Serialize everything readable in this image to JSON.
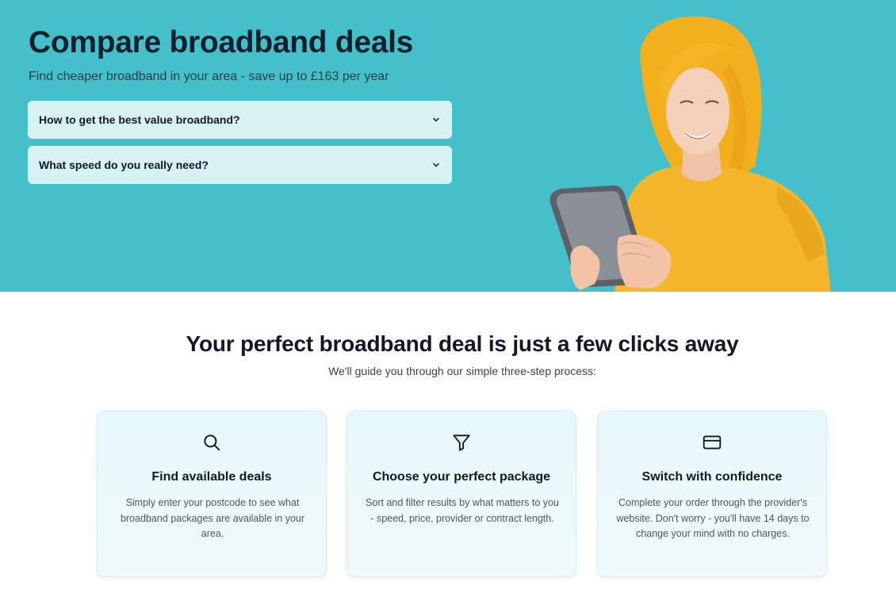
{
  "hero": {
    "title": "Compare broadband deals",
    "subtitle": "Find cheaper broadband in your area - save up to £163 per year",
    "background_color": "#45c0ca",
    "accordions": [
      {
        "label": "How to get the best value broadband?",
        "icon": "chevron-down-icon"
      },
      {
        "label": "What speed do you really need?",
        "icon": "chevron-down-icon"
      }
    ]
  },
  "process": {
    "title": "Your perfect broadband deal is just a few clicks away",
    "subtitle": "We'll guide you through our simple three-step process:",
    "steps": [
      {
        "icon": "search-icon",
        "title": "Find available deals",
        "text": "Simply enter your postcode to see what broadband packages are available in your area."
      },
      {
        "icon": "filter-icon",
        "title": "Choose your perfect package",
        "text": "Sort and filter results by what matters to you - speed, price, provider or contract length."
      },
      {
        "icon": "credit-card-icon",
        "title": "Switch with confidence",
        "text": "Complete your order through the provider's website. Don't worry - you'll have 14 days to change your mind with no charges."
      }
    ]
  }
}
